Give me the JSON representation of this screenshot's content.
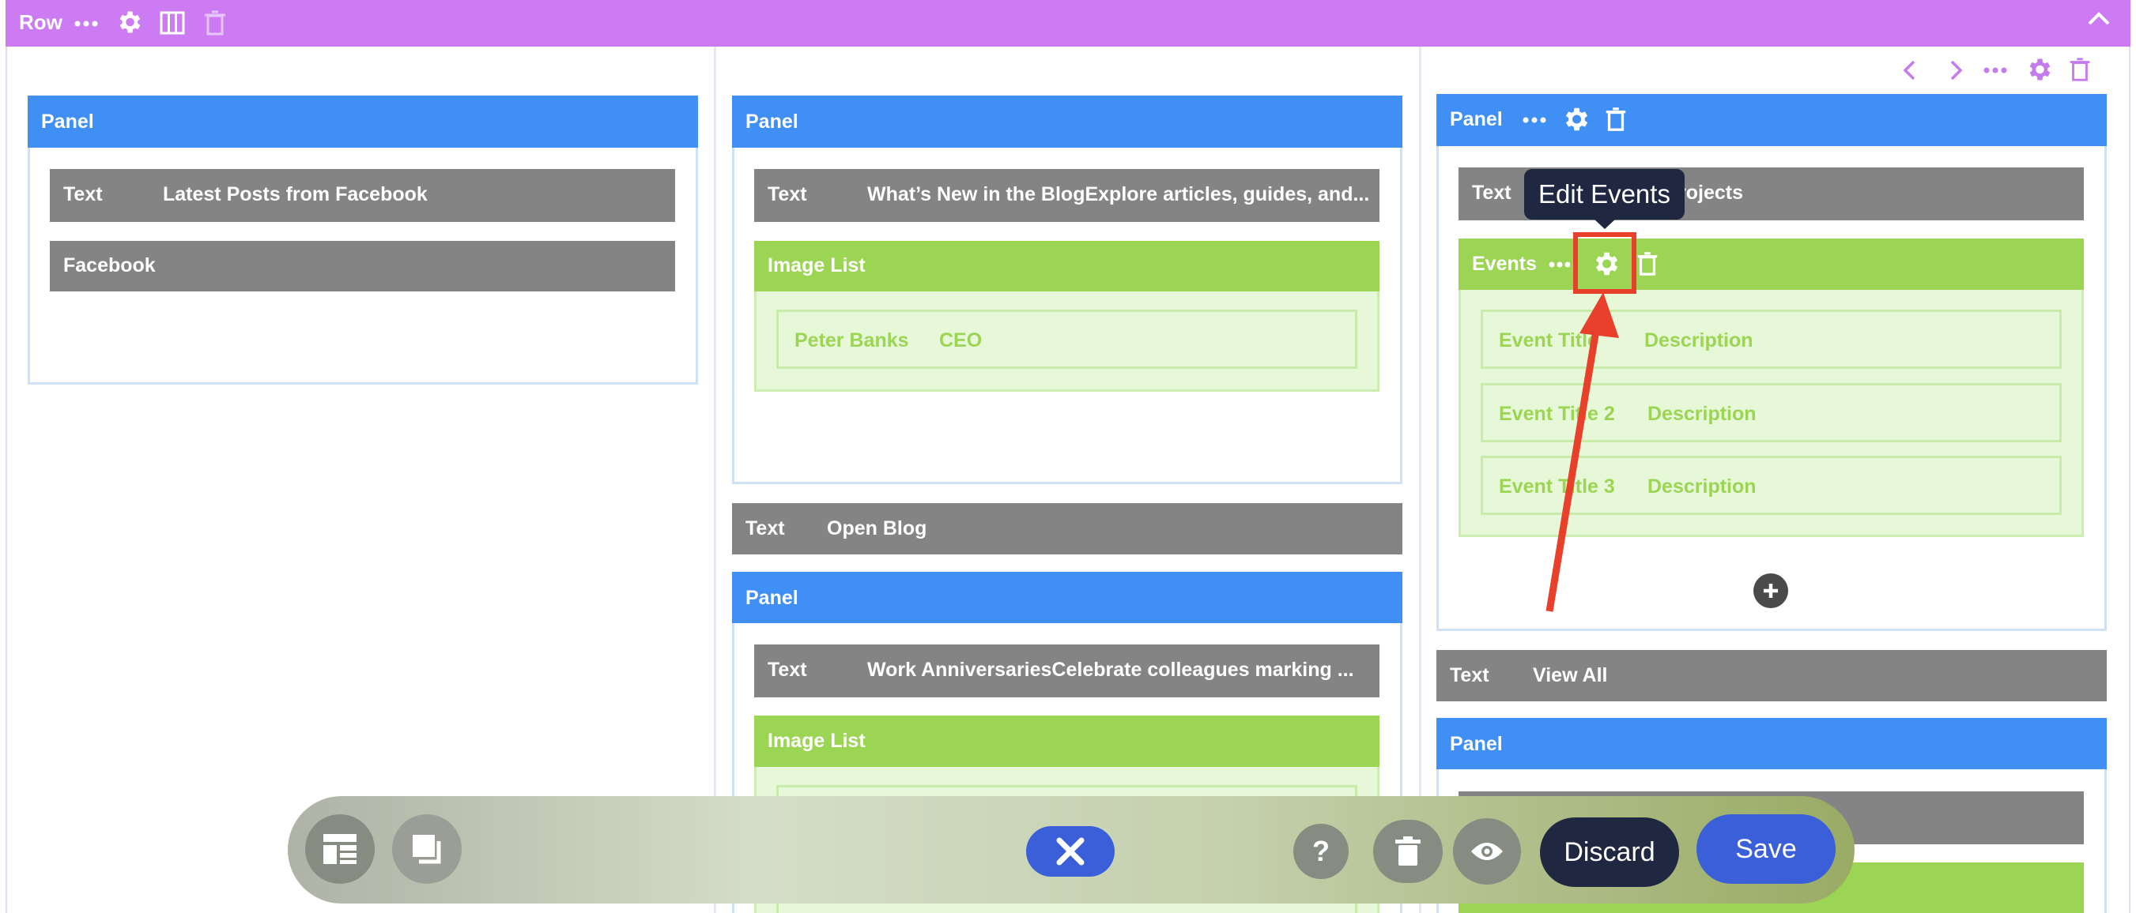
{
  "row": {
    "title": "Row",
    "icons": [
      "more-icon",
      "gear-icon",
      "columns-icon",
      "trash-icon"
    ],
    "collapse_icon": "chevron-up-icon"
  },
  "column1": {
    "panel": {
      "title": "Panel"
    },
    "text1": {
      "label": "Text",
      "value": "Latest Posts from Facebook"
    },
    "facebook": {
      "label": "Facebook"
    }
  },
  "column2": {
    "panel1": {
      "title": "Panel"
    },
    "text1": {
      "label": "Text",
      "value": "What’s New in the BlogExplore articles, guides, and..."
    },
    "imagelist1": {
      "title": "Image List",
      "item": {
        "name": "Peter Banks",
        "role": "CEO"
      }
    },
    "text_open_blog": {
      "label": "Text",
      "value": "Open Blog"
    },
    "panel2": {
      "title": "Panel"
    },
    "text2": {
      "label": "Text",
      "value": "Work AnniversariesCelebrate colleagues marking ..."
    },
    "imagelist2": {
      "title": "Image List"
    }
  },
  "column3": {
    "nav_icons": [
      "chevron-left-icon",
      "chevron-right-icon",
      "more-icon",
      "gear-icon",
      "trash-icon"
    ],
    "panel1": {
      "title": "Panel"
    },
    "text1": {
      "label": "Text",
      "value": "rojects"
    },
    "events": {
      "title": "Events",
      "items": [
        {
          "title": "Event Title",
          "desc": "Description"
        },
        {
          "title": "Event Title 2",
          "desc": "Description"
        },
        {
          "title": "Event Title 3",
          "desc": "Description"
        }
      ]
    },
    "text_view_all": {
      "label": "Text",
      "value": "View All"
    },
    "panel2": {
      "title": "Panel"
    }
  },
  "tooltip": {
    "text": "Edit Events"
  },
  "toolbar": {
    "discard": "Discard",
    "save": "Save"
  },
  "colors": {
    "row": "#cd7bf3",
    "panel": "#3f8ff4",
    "text": "#848484",
    "green": "#9bd553",
    "annotation": "#e8402b",
    "save": "#3a5fd9",
    "discard": "#1f2741"
  }
}
